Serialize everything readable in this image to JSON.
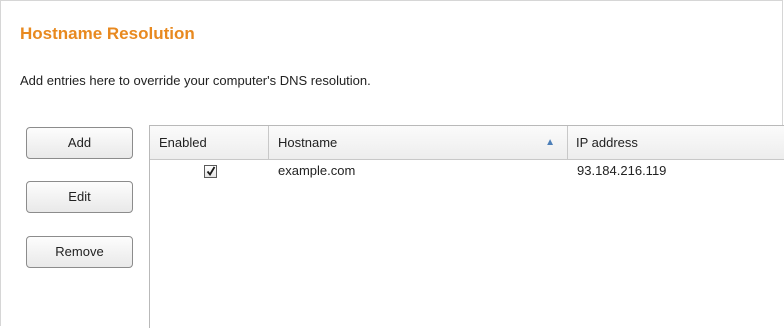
{
  "section": {
    "title": "Hostname Resolution",
    "description": "Add entries here to override your computer's DNS resolution."
  },
  "buttons": {
    "add": "Add",
    "edit": "Edit",
    "remove": "Remove"
  },
  "table": {
    "columns": {
      "enabled": "Enabled",
      "hostname": "Hostname",
      "ip": "IP address"
    },
    "sort": {
      "column": "hostname",
      "direction": "ascending"
    },
    "rows": [
      {
        "enabled": true,
        "hostname": "example.com",
        "ip": "93.184.216.119"
      }
    ]
  },
  "colors": {
    "title": "#e8891f",
    "sort_arrow": "#4d7fb8"
  }
}
